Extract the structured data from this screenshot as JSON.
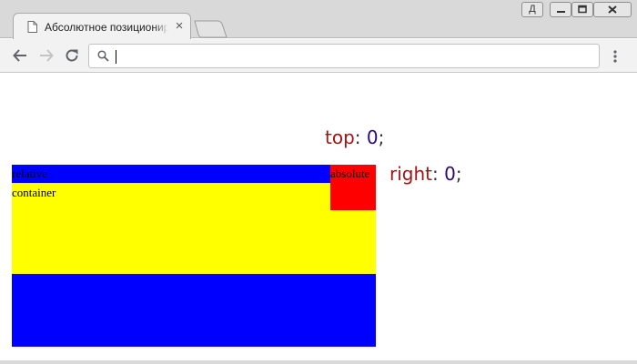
{
  "browser": {
    "tab_title": "Абсолютное позиционирование",
    "tab_close": "×",
    "address_value": "",
    "profile_label": "Д"
  },
  "page": {
    "top_prop": "top",
    "top_colon": ":",
    "top_value": "0",
    "top_semicolon": ";",
    "right_prop": "right",
    "right_colon": ":",
    "right_value": "0",
    "right_semicolon": ";",
    "relative_label": "relative",
    "container_label": "container",
    "absolute_label": "absolute"
  },
  "colors": {
    "relative_bg": "#0000ff",
    "container_bg": "#ffff00",
    "absolute_bg": "#ff0000",
    "property_color": "#a31515",
    "value_color": "#2c0a7a"
  }
}
